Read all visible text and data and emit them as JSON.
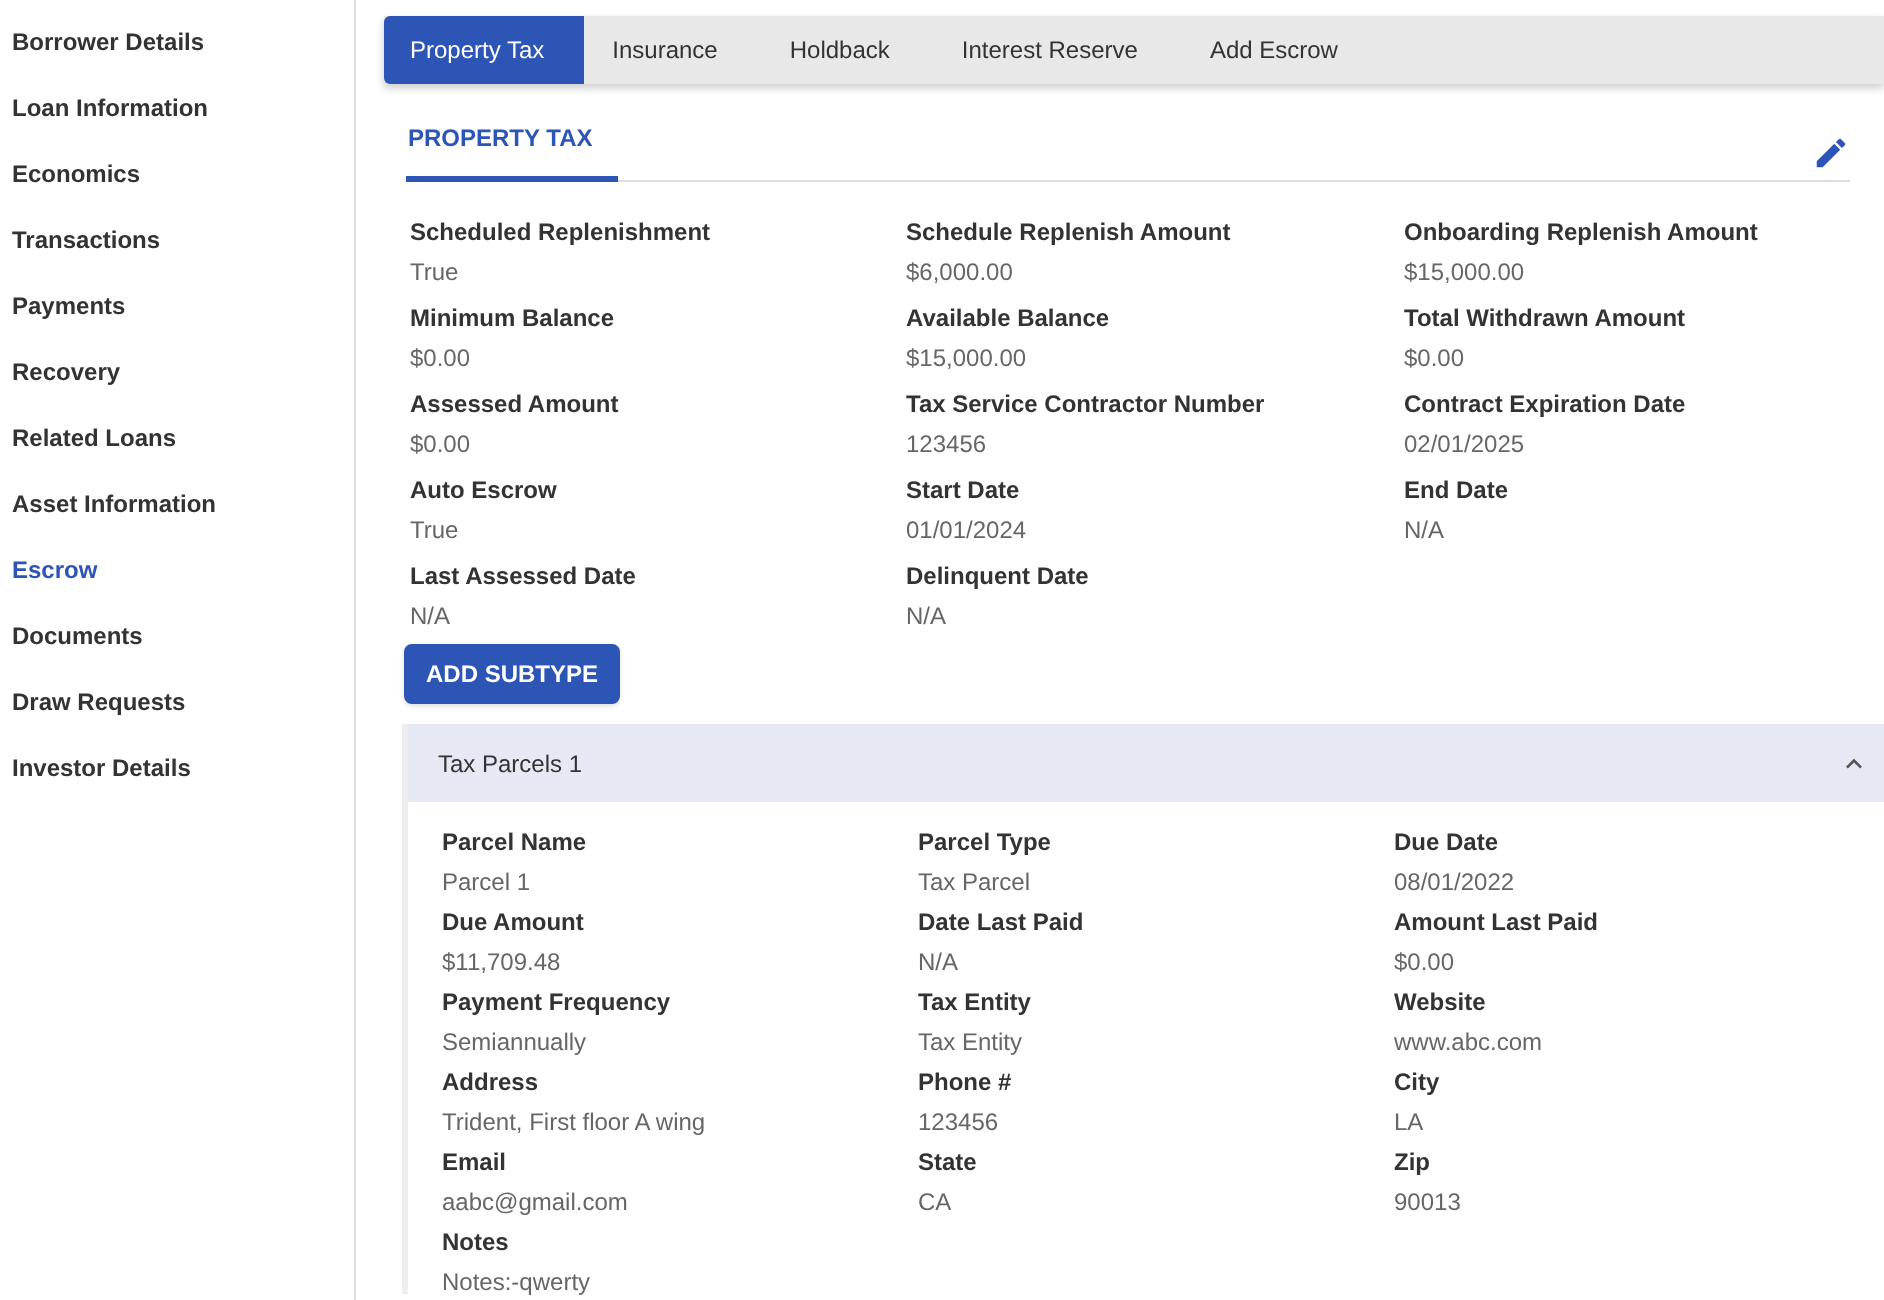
{
  "sidebar": {
    "items": [
      {
        "label": "Borrower Details",
        "selected": false
      },
      {
        "label": "Loan Information",
        "selected": false
      },
      {
        "label": "Economics",
        "selected": false
      },
      {
        "label": "Transactions",
        "selected": false
      },
      {
        "label": "Payments",
        "selected": false
      },
      {
        "label": "Recovery",
        "selected": false
      },
      {
        "label": "Related Loans",
        "selected": false
      },
      {
        "label": "Asset Information",
        "selected": false
      },
      {
        "label": "Escrow",
        "selected": true
      },
      {
        "label": "Documents",
        "selected": false
      },
      {
        "label": "Draw Requests",
        "selected": false
      },
      {
        "label": "Investor Details",
        "selected": false
      }
    ]
  },
  "tabs": [
    {
      "label": "Property Tax",
      "selected": true
    },
    {
      "label": "Insurance",
      "selected": false
    },
    {
      "label": "Holdback",
      "selected": false
    },
    {
      "label": "Interest Reserve",
      "selected": false
    },
    {
      "label": "Add Escrow",
      "selected": false
    }
  ],
  "section": {
    "title": "PROPERTY TAX",
    "fields": [
      {
        "label": "Scheduled Replenishment",
        "value": "True"
      },
      {
        "label": "Schedule Replenish Amount",
        "value": "$6,000.00"
      },
      {
        "label": "Onboarding Replenish Amount",
        "value": "$15,000.00"
      },
      {
        "label": "Minimum Balance",
        "value": "$0.00"
      },
      {
        "label": "Available Balance",
        "value": "$15,000.00"
      },
      {
        "label": "Total Withdrawn Amount",
        "value": "$0.00"
      },
      {
        "label": "Assessed Amount",
        "value": "$0.00"
      },
      {
        "label": "Tax Service Contractor Number",
        "value": "123456"
      },
      {
        "label": "Contract Expiration Date",
        "value": "02/01/2025"
      },
      {
        "label": "Auto Escrow",
        "value": "True"
      },
      {
        "label": "Start Date",
        "value": "01/01/2024"
      },
      {
        "label": "End Date",
        "value": "N/A"
      },
      {
        "label": "Last Assessed Date",
        "value": "N/A"
      },
      {
        "label": "Delinquent Date",
        "value": "N/A"
      }
    ],
    "button": "ADD SUBTYPE",
    "accordion": {
      "title": "Tax Parcels 1",
      "expanded": true,
      "fields": [
        {
          "label": "Parcel Name",
          "value": "Parcel 1"
        },
        {
          "label": "Parcel Type",
          "value": "Tax Parcel"
        },
        {
          "label": "Due Date",
          "value": "08/01/2022"
        },
        {
          "label": "Due Amount",
          "value": "$11,709.48"
        },
        {
          "label": "Date Last Paid",
          "value": "N/A"
        },
        {
          "label": "Amount Last Paid",
          "value": "$0.00"
        },
        {
          "label": "Payment Frequency",
          "value": "Semiannually"
        },
        {
          "label": "Tax Entity",
          "value": "Tax Entity"
        },
        {
          "label": "Website",
          "value": "www.abc.com"
        },
        {
          "label": "Address",
          "value": "Trident, First floor A wing"
        },
        {
          "label": "Phone #",
          "value": "123456"
        },
        {
          "label": "City",
          "value": "LA"
        },
        {
          "label": "Email",
          "value": "aabc@gmail.com"
        },
        {
          "label": "State",
          "value": "CA"
        },
        {
          "label": "Zip",
          "value": "90013"
        },
        {
          "label": "Notes",
          "value": "Notes:-qwerty"
        }
      ]
    }
  }
}
